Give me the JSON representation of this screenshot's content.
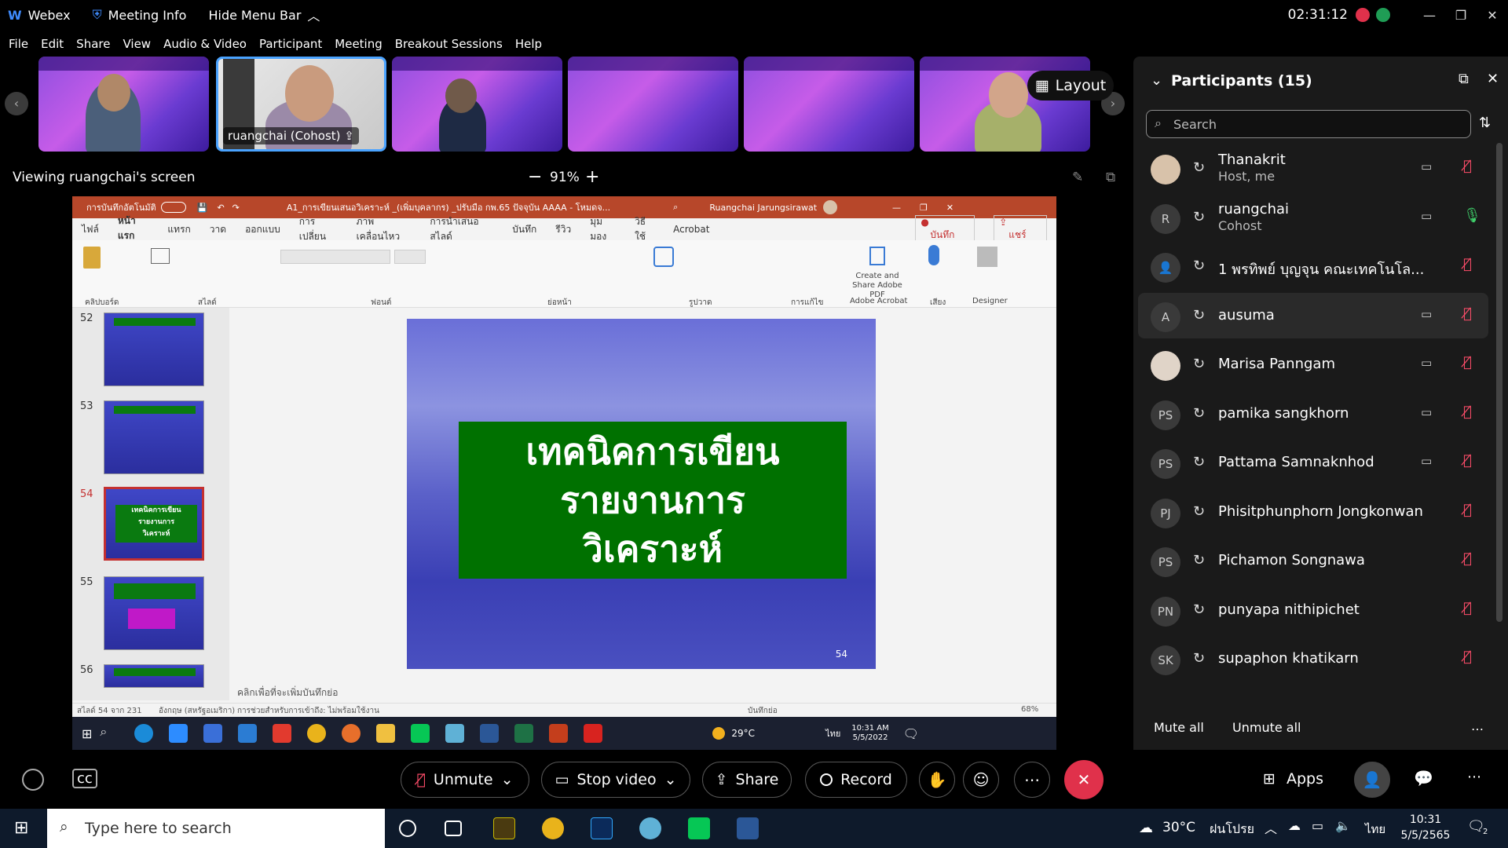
{
  "titlebar": {
    "app": "Webex",
    "meeting_info": "Meeting Info",
    "hide_menu": "Hide Menu Bar",
    "time": "02:31:12"
  },
  "menu": [
    "File",
    "Edit",
    "Share",
    "View",
    "Audio & Video",
    "Participant",
    "Meeting",
    "Breakout Sessions",
    "Help"
  ],
  "filmstrip": {
    "active_name": "ruangchai (Cohost)",
    "layout_label": "Layout"
  },
  "viewbar": {
    "viewing": "Viewing ruangchai's screen",
    "zoom": "91%"
  },
  "powerpoint": {
    "title": "A1_การเขียนเสนอวิเคราะห์ _(เพิ่มบุคลากร) _ปรับมือ กพ.65 ปัจจุบัน AAAA - โหมดจ...",
    "user": "Ruangchai Jarungsirawat",
    "tabs": [
      "ไฟล์",
      "หน้าแรก",
      "แทรก",
      "วาด",
      "ออกแบบ",
      "การเปลี่ยน",
      "ภาพเคลื่อนไหว",
      "การนำเสนอสไลด์",
      "บันทึก",
      "รีวิว",
      "มุมมอง",
      "วิธีใช้",
      "Acrobat"
    ],
    "record": "บันทึก",
    "share": "แชร์",
    "ribbon_groups": [
      "คลิปบอร์ด",
      "สไลด์",
      "ฟอนต์",
      "ย่อหน้า",
      "รูปวาด",
      "การแก้ไข",
      "Adobe Acrobat",
      "เสียง",
      "Designer"
    ],
    "ribbon_labels": {
      "adobe": "Create and Share Adobe PDF"
    },
    "thumbs": [
      "52",
      "53",
      "54",
      "55",
      "56"
    ],
    "thumb54_lines": [
      "เทคนิคการเขียน",
      "รายงานการ",
      "วิเคราะห์"
    ],
    "slide_lines": [
      "เทคนิคการเขียน",
      "รายงานการ",
      "วิเคราะห์"
    ],
    "slide_number": "54",
    "notes_placeholder": "คลิกเพื่อที่จะเพิ่มบันทึกย่อ",
    "status_left": "สไลด์ 54 จาก 231",
    "status_lang": "อังกฤษ (สหรัฐอเมริกา)",
    "status_access": "การช่วยสำหรับการเข้าถึง: ไม่พร้อมใช้งาน",
    "status_notes": "บันทึกย่อ",
    "status_zoom": "68%",
    "inner_weather": "29°C",
    "inner_time": "10:31 AM",
    "inner_date": "5/5/2022",
    "inner_lang": "ไทย"
  },
  "panel": {
    "title": "Participants (15)",
    "search_placeholder": "Search",
    "participants": [
      {
        "name": "Thanakrit",
        "role": "Host, me",
        "initials": "",
        "video": true
      },
      {
        "name": "ruangchai",
        "role": "Cohost",
        "initials": "R",
        "video": true
      },
      {
        "name": "1 พรทิพย์ บุญจุน คณะเทคโนโล...",
        "role": "",
        "initials": "",
        "video": false
      },
      {
        "name": "ausuma",
        "role": "",
        "initials": "A",
        "video": true
      },
      {
        "name": "Marisa Panngam",
        "role": "",
        "initials": "",
        "video": true
      },
      {
        "name": "pamika sangkhorn",
        "role": "",
        "initials": "PS",
        "video": true
      },
      {
        "name": "Pattama Samnaknhod",
        "role": "",
        "initials": "PS",
        "video": true
      },
      {
        "name": "Phisitphunphorn Jongkonwan",
        "role": "",
        "initials": "PJ",
        "video": false
      },
      {
        "name": "Pichamon Songnawa",
        "role": "",
        "initials": "PS",
        "video": false
      },
      {
        "name": "punyapa nithipichet",
        "role": "",
        "initials": "PN",
        "video": false
      },
      {
        "name": "supaphon khatikarn",
        "role": "",
        "initials": "SK",
        "video": false
      }
    ],
    "mute_all": "Mute all",
    "unmute_all": "Unmute all"
  },
  "controls": {
    "unmute": "Unmute",
    "stop_video": "Stop video",
    "share": "Share",
    "record": "Record",
    "apps": "Apps"
  },
  "taskbar": {
    "search": "Type here to search",
    "weather": "30°C",
    "weather_desc": "ฝนโปรย",
    "lang": "ไทย",
    "time": "10:31",
    "date": "5/5/2565",
    "notif": "2"
  }
}
